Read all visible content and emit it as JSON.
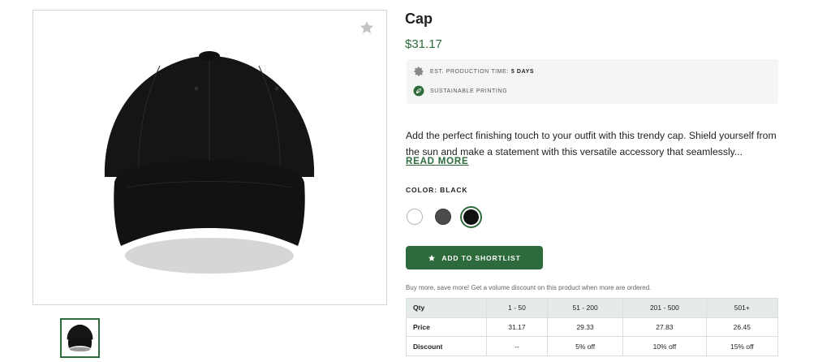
{
  "product": {
    "title": "Cap",
    "price": "$31.17"
  },
  "info": {
    "production_label": "EST. PRODUCTION TIME:",
    "production_value": "5 DAYS",
    "production_icon": "gear-icon",
    "sustainable_label": "SUSTAINABLE PRINTING",
    "sustainable_icon": "leaf-icon"
  },
  "description": {
    "text": "Add the perfect finishing touch to your outfit with this trendy cap. Shield yourself from the sun and make a statement with this versatile accessory that seamlessly...",
    "read_more": "READ MORE"
  },
  "color": {
    "label": "COLOR: BLACK",
    "options": [
      "white",
      "dark grey",
      "black"
    ],
    "selected": "black"
  },
  "shortlist": {
    "label": "ADD TO SHORTLIST"
  },
  "volume": {
    "note": "Buy more, save more! Get a volume discount on this product when more are ordered.",
    "header": [
      "Qty",
      "1 - 50",
      "51 - 200",
      "201 - 500",
      "501+"
    ],
    "rows": [
      [
        "Price",
        "31.17",
        "29.33",
        "27.83",
        "26.45"
      ],
      [
        "Discount",
        "--",
        "5% off",
        "10% off",
        "15% off"
      ]
    ]
  },
  "colors": {
    "accent": "#2e6b3c",
    "table_header_bg": "#e5ebe6",
    "info_bg": "#f5f5f5"
  }
}
